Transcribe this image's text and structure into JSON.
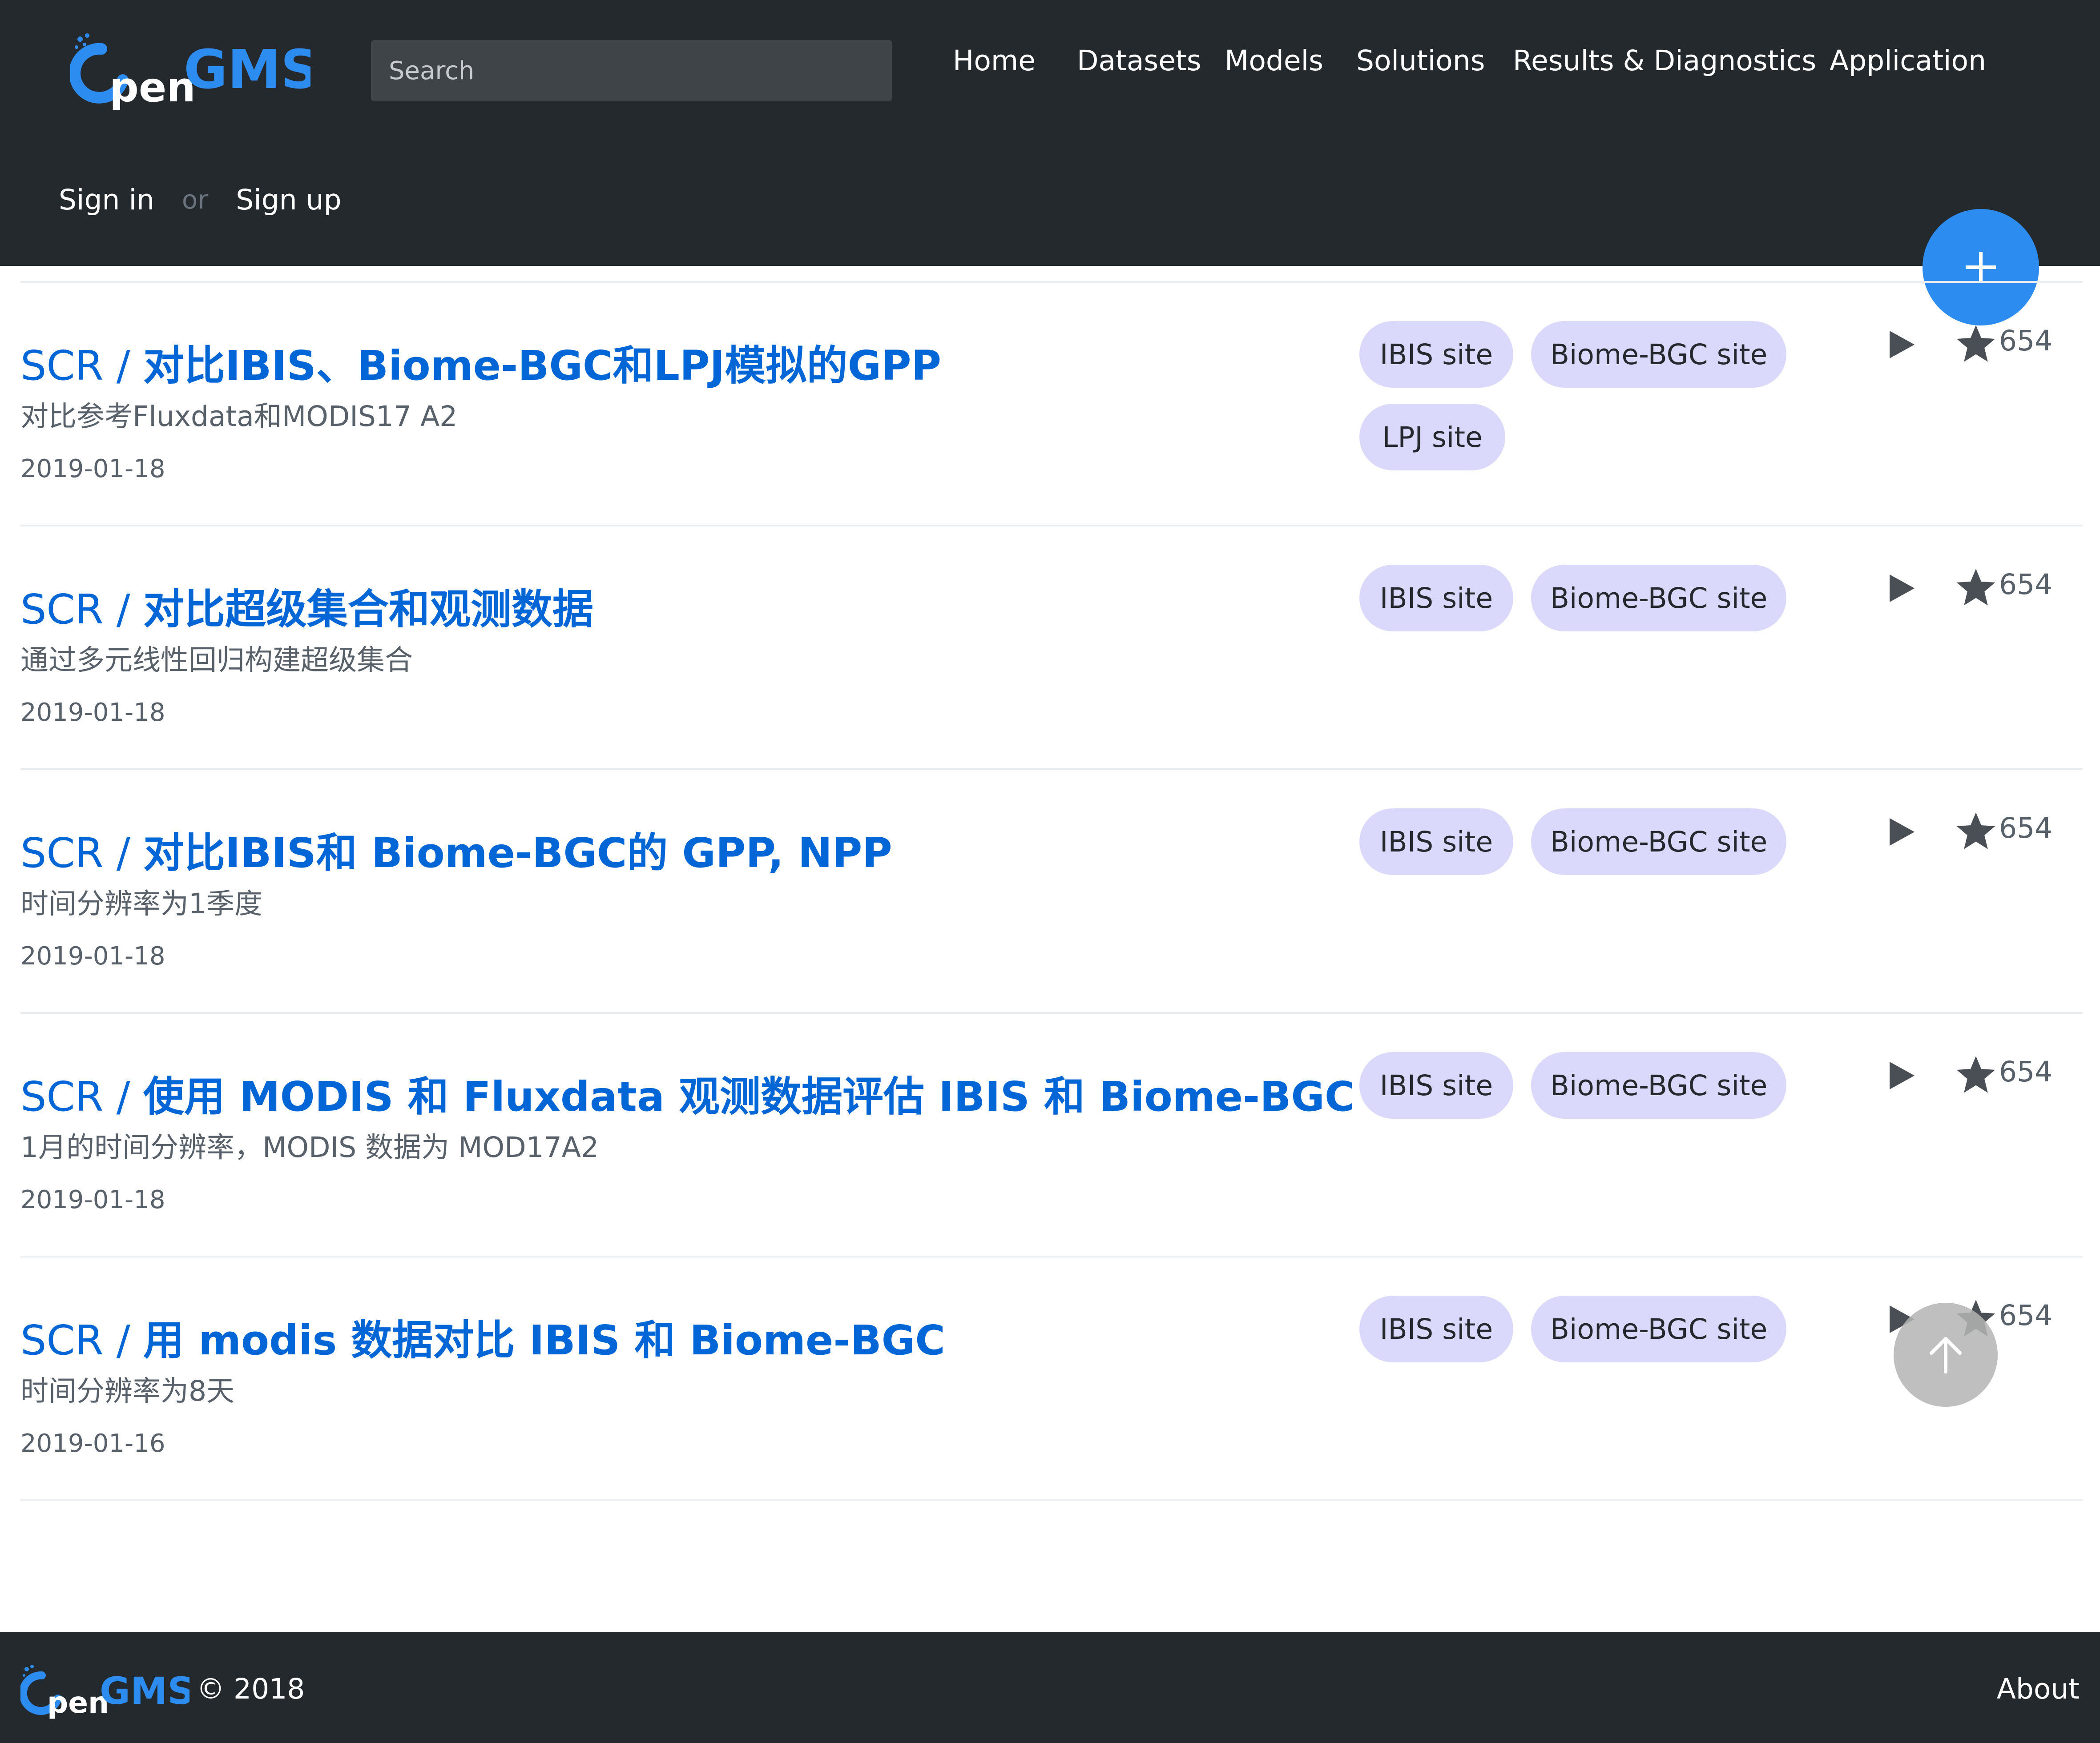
{
  "header": {
    "logo_text": "OpenGMS",
    "search_placeholder": "Search",
    "nav": [
      "Home",
      "Datasets",
      "Models",
      "Solutions",
      "Results & Diagnostics",
      "Application"
    ],
    "sign_in": "Sign in",
    "or": "or",
    "sign_up": "Sign up"
  },
  "fab_icon": "plus-icon",
  "items": [
    {
      "prefix": "SCR / ",
      "title": "对比IBIS、Biome-BGC和LPJ模拟的GPP",
      "desc": "对比参考Fluxdata和MODIS17 A2",
      "date": "2019-01-18",
      "tags": [
        "IBIS site",
        "Biome-BGC site",
        "LPJ site"
      ],
      "stars": "654"
    },
    {
      "prefix": "SCR / ",
      "title": "对比超级集合和观测数据",
      "desc": "通过多元线性回归构建超级集合",
      "date": "2019-01-18",
      "tags": [
        "IBIS site",
        "Biome-BGC site"
      ],
      "stars": "654"
    },
    {
      "prefix": "SCR / ",
      "title": "对比IBIS和 Biome-BGC的 GPP, NPP",
      "desc": "时间分辨率为1季度",
      "date": "2019-01-18",
      "tags": [
        "IBIS site",
        "Biome-BGC site"
      ],
      "stars": "654"
    },
    {
      "prefix": "SCR / ",
      "title": "使用 MODIS 和 Fluxdata 观测数据评估 IBIS 和 Biome-BGC",
      "desc": "1月的时间分辨率，MODIS 数据为 MOD17A2",
      "date": "2019-01-18",
      "tags": [
        "IBIS site",
        "Biome-BGC site"
      ],
      "stars": "654"
    },
    {
      "prefix": "SCR / ",
      "title": "用 modis 数据对比 IBIS 和 Biome-BGC",
      "desc": "时间分辨率为8天",
      "date": "2019-01-16",
      "tags": [
        "IBIS site",
        "Biome-BGC site"
      ],
      "stars": "654"
    }
  ],
  "scroll_top_icon": "arrow-up-icon",
  "footer": {
    "logo_text": "OpenGMS",
    "copyright": "© 2018",
    "about": "About"
  },
  "colors": {
    "header_bg": "#24292e",
    "link": "#0366d6",
    "tag_bg": "#dbd9fb",
    "fab": "#2d8cf0"
  }
}
